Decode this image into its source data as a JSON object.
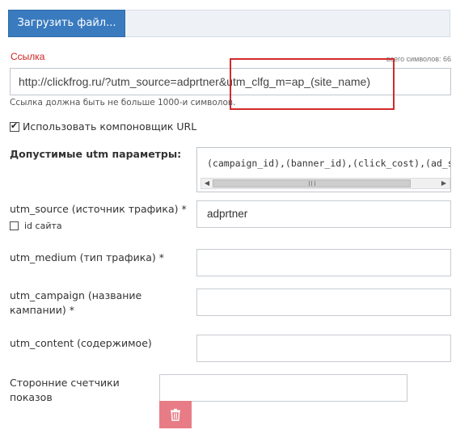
{
  "toolbar": {
    "upload_label": "Загрузить файл..."
  },
  "link": {
    "label": "Ссылка",
    "char_count": "всего символов: 66",
    "url_value": "http://clickfrog.ru/?utm_source=adprtner&utm_clfg_m=ap_(site_name)",
    "hint": "Ссылка должна быть не больше 1000-и символов."
  },
  "builder": {
    "label": "Использовать компоновщик URL",
    "checked": true
  },
  "params": {
    "label": "Допустимые utm параметры:",
    "value": "(campaign_id),(banner_id),(click_cost),(ad_s"
  },
  "fields": {
    "utm_source": {
      "label": "utm_source (источник трафика) *",
      "value": "adprtner",
      "site_id_label": "id сайта"
    },
    "utm_medium": {
      "label": "utm_medium (тип трафика) *",
      "value": ""
    },
    "utm_campaign": {
      "label": "utm_campaign (название кампании) *",
      "value": ""
    },
    "utm_content": {
      "label": "utm_content (содержимое)",
      "value": ""
    },
    "counters": {
      "label": "Сторонние счетчики показов",
      "value": ""
    }
  },
  "colors": {
    "accent": "#3a7bbf",
    "error_label": "#cc2222",
    "highlight": "#d22a2a",
    "delete": "#e87c86"
  },
  "icons": {
    "delete": "trash-icon"
  }
}
